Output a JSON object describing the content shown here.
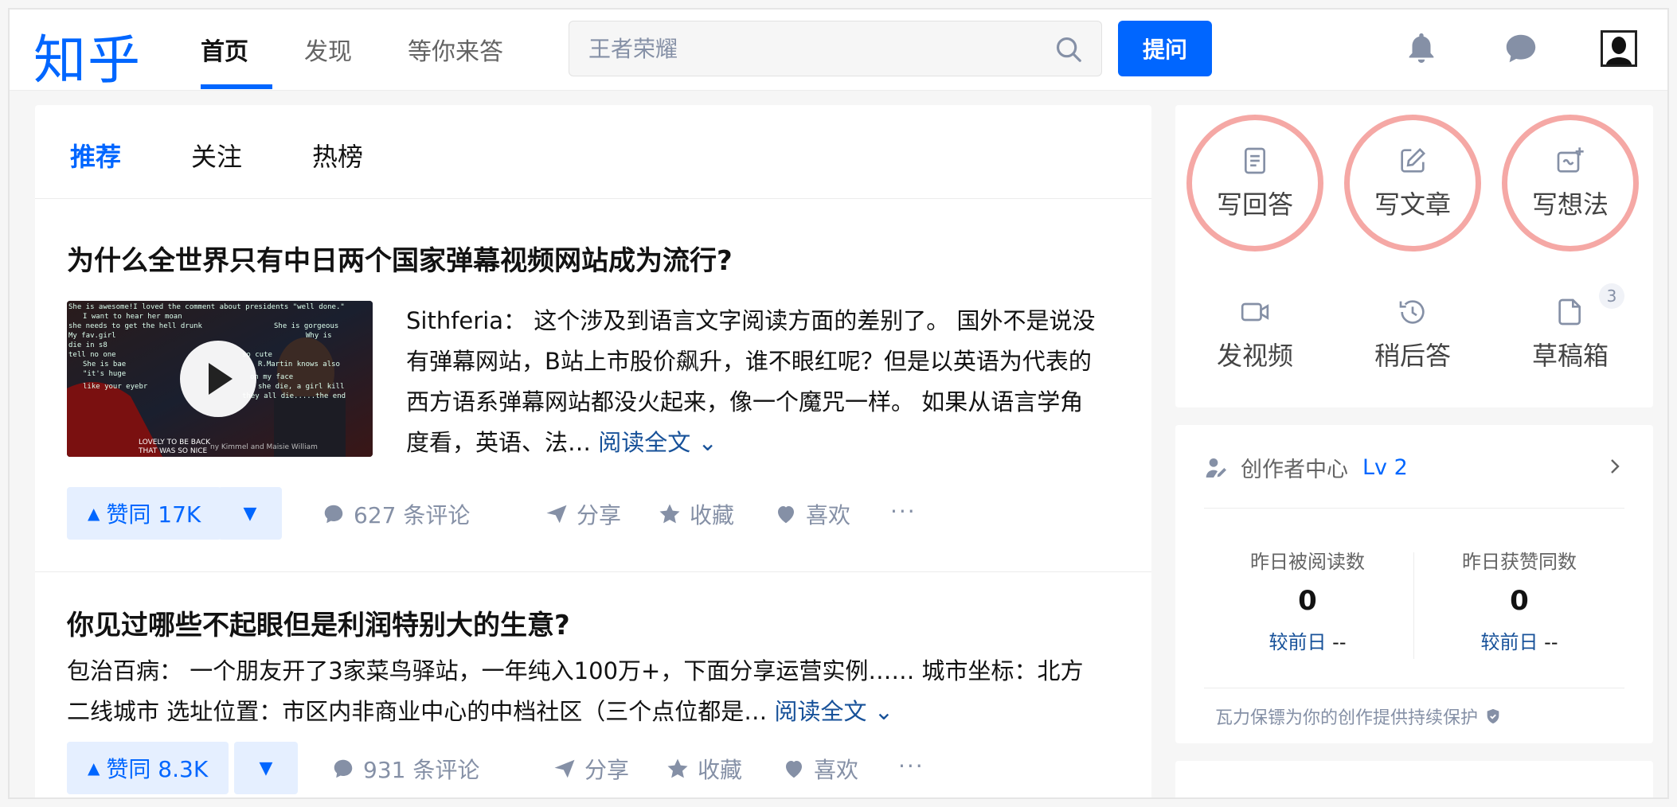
{
  "header": {
    "logo": "知乎",
    "nav": [
      {
        "label": "首页"
      },
      {
        "label": "发现"
      },
      {
        "label": "等你来答"
      }
    ],
    "search_placeholder": "王者荣耀",
    "ask_label": "提问"
  },
  "feed": {
    "tabs": [
      {
        "label": "推荐"
      },
      {
        "label": "关注"
      },
      {
        "label": "热榜"
      }
    ],
    "items": [
      {
        "title": "为什么全世界只有中日两个国家弹幕视频网站成为流行?",
        "excerpt_lines": [
          "Sithferia： 这个涉及到语言文字阅读方面的差别了。 国外不是说没",
          "有弹幕网站，B站上市股价飙升，谁不眼红呢？但是以英语为代表的",
          "西方语系弹幕网站都没火起来，像一个魔咒一样。 如果从语言学角",
          "度看，英语、法…"
        ],
        "read_more": "阅读全文",
        "vote_label": "赞同 17K",
        "comments": "627 条评论",
        "share": "分享",
        "collect": "收藏",
        "like": "喜欢",
        "thumb_captions": [
          "LOVELY TO BE BACK",
          "THAT WAS SO NICE",
          "ny Kimmel and Maisie William"
        ]
      },
      {
        "title": "你见过哪些不起眼但是利润特别大的生意?",
        "excerpt_lines": [
          "包治百病： 一个朋友开了3家菜鸟驿站，一年纯入100万+，下面分享运营实例…… 城市坐标：北方",
          "二线城市 选址位置：市区内非商业中心的中档社区（三个点位都是…"
        ],
        "read_more": "阅读全文",
        "vote_label": "赞同 8.3K",
        "comments": "931 条评论",
        "share": "分享",
        "collect": "收藏",
        "like": "喜欢"
      }
    ]
  },
  "sidebar": {
    "tools": [
      {
        "label": "写回答",
        "icon": "answer-doc-icon"
      },
      {
        "label": "写文章",
        "icon": "edit-pen-icon"
      },
      {
        "label": "写想法",
        "icon": "idea-icon"
      },
      {
        "label": "发视频",
        "icon": "video-camera-icon"
      },
      {
        "label": "稍后答",
        "icon": "history-clock-icon"
      },
      {
        "label": "草稿箱",
        "icon": "draft-file-icon",
        "badge": "3"
      }
    ],
    "creator": {
      "title": "创作者中心",
      "level": "Lv 2",
      "stats": [
        {
          "label": "昨日被阅读数",
          "value": "0",
          "compare_label": "较前日",
          "compare_value": "--"
        },
        {
          "label": "昨日获赞同数",
          "value": "0",
          "compare_label": "较前日",
          "compare_value": "--"
        }
      ],
      "protect_text": "瓦力保镖为你的创作提供持续保护"
    }
  },
  "colors": {
    "brand": "#0066ff",
    "highlight_circle": "#f5a8a5",
    "muted": "#8590a6"
  }
}
